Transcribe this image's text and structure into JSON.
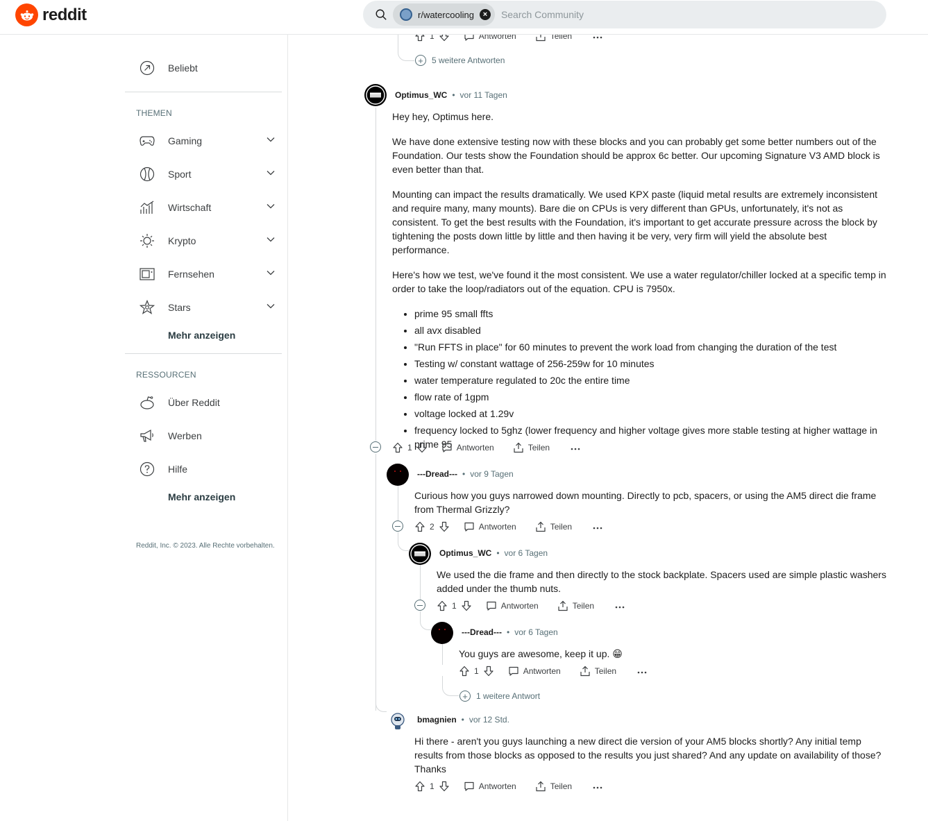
{
  "header": {
    "logo_text": "reddit",
    "chip_label": "r/watercooling",
    "search_placeholder": "Search Community"
  },
  "sidebar": {
    "popular": "Beliebt",
    "topics_heading": "THEMEN",
    "topics": [
      {
        "label": "Gaming",
        "icon": "gamepad-icon"
      },
      {
        "label": "Sport",
        "icon": "ball-icon"
      },
      {
        "label": "Wirtschaft",
        "icon": "chart-icon"
      },
      {
        "label": "Krypto",
        "icon": "crypto-icon"
      },
      {
        "label": "Fernsehen",
        "icon": "tv-icon"
      },
      {
        "label": "Stars",
        "icon": "star-icon"
      }
    ],
    "more_topics": "Mehr anzeigen",
    "resources_heading": "RESSOURCEN",
    "resources": [
      {
        "label": "Über Reddit",
        "icon": "reddit-alien-icon"
      },
      {
        "label": "Werben",
        "icon": "megaphone-icon"
      },
      {
        "label": "Hilfe",
        "icon": "help-icon"
      }
    ],
    "more_resources": "Mehr anzeigen",
    "footer": "Reddit, Inc. © 2023. Alle Rechte vorbehalten."
  },
  "labels": {
    "reply": "Antworten",
    "share": "Teilen"
  },
  "top": {
    "votes": "1",
    "more_replies": "5 weitere Antworten"
  },
  "comments": [
    {
      "author": "Optimus_WC",
      "time": "vor 11 Tagen",
      "paragraphs": [
        "Hey hey, Optimus here.",
        "We have done extensive testing now with these blocks and you can probably get some better numbers out of the Foundation. Our tests show the Foundation should be approx 6c better. Our upcoming Signature V3 AMD block is even better than that.",
        "Mounting can impact the results dramatically. We used KPX paste (liquid metal results are extremely inconsistent and require many, many mounts). Bare die on CPUs is very different than GPUs, unfortunately, it's not as consistent. To get the best results with the Foundation, it's important to get accurate pressure across the block by tightening the posts down little by little and then having it be very, very firm will yield the absolute best performance.",
        "Here's how we test, we've found it the most consistent. We use a water regulator/chiller locked at a specific temp in order to take the loop/radiators out of the equation. CPU is 7950x."
      ],
      "bullets": [
        "prime 95 small ffts",
        "all avx disabled",
        "\"Run FFTS in place\" for 60 minutes to prevent the work load from changing the duration of the test",
        "Testing w/ constant wattage of 256-259w for 10 minutes",
        "water temperature regulated to 20c the entire time",
        "flow rate of 1gpm",
        "voltage locked at 1.29v",
        "frequency locked to 5ghz (lower frequency and higher voltage gives more stable testing at higher wattage in prime 95"
      ],
      "votes": "1"
    },
    {
      "author": "---Dread---",
      "time": "vor 9 Tagen",
      "text": "Curious how you guys narrowed down mounting. Directly to pcb, spacers, or using the AM5 direct die frame from Thermal Grizzly?",
      "votes": "2"
    },
    {
      "author": "Optimus_WC",
      "time": "vor 6 Tagen",
      "text": "We used the die frame and then directly to the stock backplate. Spacers used are simple plastic washers added under the thumb nuts.",
      "votes": "1"
    },
    {
      "author": "---Dread---",
      "time": "vor 6 Tagen",
      "text": "You guys are awesome, keep it up. 😁",
      "votes": "1",
      "more_replies": "1 weitere Antwort"
    },
    {
      "author": "bmagnien",
      "time": "vor 12 Std.",
      "text": "Hi there - aren't you guys launching a new direct die version of your AM5 blocks shortly? Any initial temp results from those blocks as opposed to the results you just shared? And any update on availability of those? Thanks",
      "votes": "1"
    }
  ]
}
